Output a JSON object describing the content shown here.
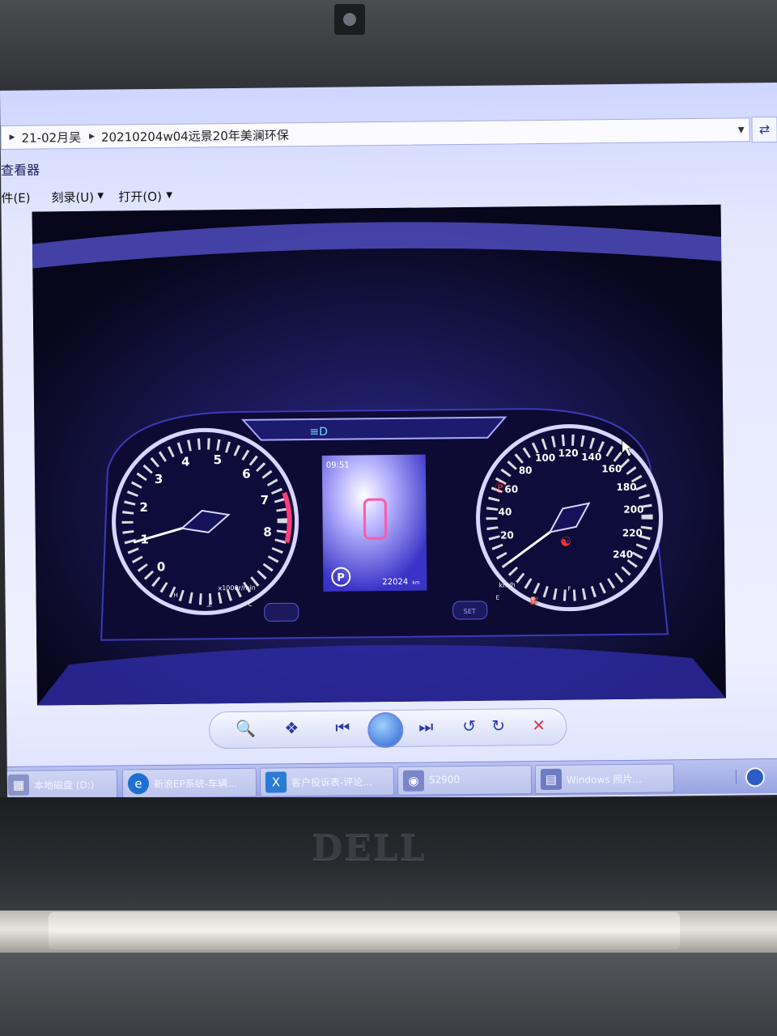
{
  "address_bar": {
    "crumbs": [
      "21-02月吴",
      "20210204w04远景20年美澜环保"
    ]
  },
  "window_title": "查看器",
  "menu": {
    "items": [
      {
        "label": "件(E)"
      },
      {
        "label": "刻录(U)"
      },
      {
        "label": "打开(O)"
      }
    ]
  },
  "cluster": {
    "clock": "09:51",
    "odometer": "22024",
    "odometer_unit": "km",
    "gear": "P",
    "tacho_labels": [
      "0",
      "1",
      "2",
      "3",
      "4",
      "5",
      "6",
      "7",
      "8"
    ],
    "tacho_unit": "x1000r/min",
    "speed_labels": [
      "20",
      "40",
      "60",
      "80",
      "100",
      "120",
      "140",
      "160",
      "180",
      "200",
      "220",
      "240"
    ],
    "speed_unit": "km/h",
    "temp_h": "H",
    "temp_c": "C",
    "fuel_e": "E",
    "fuel_f": "F",
    "set_label": "SET",
    "rpm_value": 1,
    "speed_value": 0
  },
  "taskbar": {
    "items": [
      {
        "label": "本地磁盘 (D:)",
        "icon": "drive-icon"
      },
      {
        "label": "新浪EP系统-车辆...",
        "icon": "edge-icon"
      },
      {
        "label": "客户投诉表-评论...",
        "icon": "excel-icon"
      },
      {
        "label": "S2900",
        "icon": "camera-icon"
      },
      {
        "label": "Windows 照片...",
        "icon": "photo-viewer-icon"
      }
    ]
  },
  "brand": "DELL"
}
